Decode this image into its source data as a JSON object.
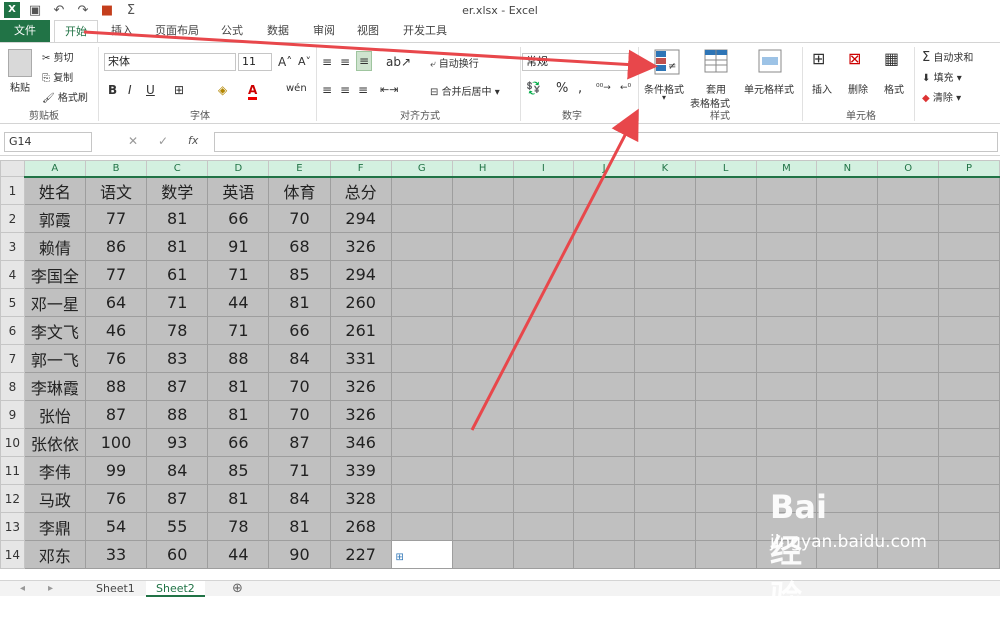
{
  "window_title": "er.xlsx - Excel",
  "tabs": [
    "文件",
    "开始",
    "插入",
    "页面布局",
    "公式",
    "数据",
    "审阅",
    "视图",
    "开发工具"
  ],
  "clipboard": {
    "paste": "粘贴",
    "cut": "剪切",
    "copy": "复制",
    "format_painter": "格式刷",
    "label": "剪贴板"
  },
  "font": {
    "name": "宋体",
    "size": "11",
    "label": "字体",
    "bold": "B",
    "italic": "I",
    "underline": "U"
  },
  "alignment": {
    "wrap": "自动换行",
    "merge": "合并后居中",
    "label": "对齐方式"
  },
  "number": {
    "format": "常规",
    "percent": "%",
    "comma": ",",
    "label": "数字"
  },
  "styles": {
    "conditional": "条件格式",
    "table_format_1": "套用",
    "table_format_2": "表格格式",
    "cell_styles": "单元格样式",
    "label": "样式"
  },
  "cells": {
    "insert": "插入",
    "delete": "删除",
    "format": "格式",
    "label": "单元格"
  },
  "editing": {
    "autosum": "自动求和",
    "fill": "填充",
    "clear": "清除"
  },
  "formula_bar": {
    "name_box": "G14",
    "fx": "fx",
    "value": ""
  },
  "columns": [
    "A",
    "B",
    "C",
    "D",
    "E",
    "F",
    "G",
    "H",
    "I",
    "J",
    "K",
    "L",
    "M",
    "N",
    "O",
    "P"
  ],
  "rows": [
    [
      "姓名",
      "语文",
      "数学",
      "英语",
      "体育",
      "总分"
    ],
    [
      "郭霞",
      "77",
      "81",
      "66",
      "70",
      "294"
    ],
    [
      "赖倩",
      "86",
      "81",
      "91",
      "68",
      "326"
    ],
    [
      "李国全",
      "77",
      "61",
      "71",
      "85",
      "294"
    ],
    [
      "邓一星",
      "64",
      "71",
      "44",
      "81",
      "260"
    ],
    [
      "李文飞",
      "46",
      "78",
      "71",
      "66",
      "261"
    ],
    [
      "郭一飞",
      "76",
      "83",
      "88",
      "84",
      "331"
    ],
    [
      "李琳霞",
      "88",
      "87",
      "81",
      "70",
      "326"
    ],
    [
      "张怡",
      "87",
      "88",
      "81",
      "70",
      "326"
    ],
    [
      "张依依",
      "100",
      "93",
      "66",
      "87",
      "346"
    ],
    [
      "李伟",
      "99",
      "84",
      "85",
      "71",
      "339"
    ],
    [
      "马政",
      "76",
      "87",
      "81",
      "84",
      "328"
    ],
    [
      "李鼎",
      "54",
      "55",
      "78",
      "81",
      "268"
    ],
    [
      "邓东",
      "33",
      "60",
      "44",
      "90",
      "227"
    ]
  ],
  "sheets": [
    "Sheet1",
    "Sheet2"
  ],
  "watermark": {
    "brand": "Bai 经验",
    "url": "jingyan.baidu.com"
  },
  "colors": {
    "excel_green": "#217346",
    "arrow_red": "#e8474b",
    "cell_bg": "#c0c0c0"
  }
}
